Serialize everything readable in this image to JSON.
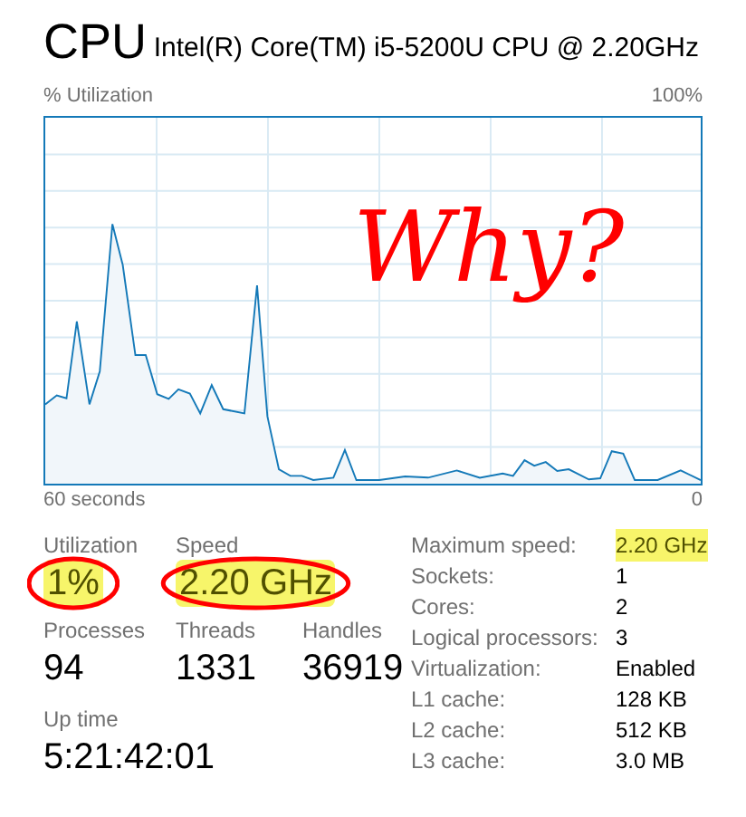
{
  "header": {
    "title": "CPU",
    "model": "Intel(R) Core(TM) i5-5200U CPU @ 2.20GHz"
  },
  "graph": {
    "label": "% Utilization",
    "max_label": "100%",
    "time_label": "60 seconds",
    "end_label": "0",
    "annotation": "Why?"
  },
  "stat_rows": [
    [
      {
        "label": "Utilization",
        "value": "1%",
        "highlighted": true,
        "circled": true
      },
      {
        "label": "Speed",
        "value": "2.20 GHz",
        "highlighted": true,
        "circled": true
      }
    ],
    [
      {
        "label": "Processes",
        "value": "94",
        "highlighted": false,
        "circled": false
      },
      {
        "label": "Threads",
        "value": "1331",
        "highlighted": false,
        "circled": false
      },
      {
        "label": "Handles",
        "value": "36919",
        "highlighted": false,
        "circled": false
      }
    ]
  ],
  "uptime": {
    "label": "Up time",
    "value": "5:21:42:01"
  },
  "details": [
    {
      "label": "Maximum speed:",
      "value": "2.20 GHz",
      "highlighted": true
    },
    {
      "label": "Sockets:",
      "value": "1",
      "highlighted": false
    },
    {
      "label": "Cores:",
      "value": "2",
      "highlighted": false
    },
    {
      "label": "Logical processors:",
      "value": "3",
      "highlighted": false
    },
    {
      "label": "Virtualization:",
      "value": "Enabled",
      "highlighted": false
    },
    {
      "label": "L1 cache:",
      "value": "128 KB",
      "highlighted": false
    },
    {
      "label": "L2 cache:",
      "value": "512 KB",
      "highlighted": false
    },
    {
      "label": "L3 cache:",
      "value": "3.0 MB",
      "highlighted": false
    }
  ]
}
